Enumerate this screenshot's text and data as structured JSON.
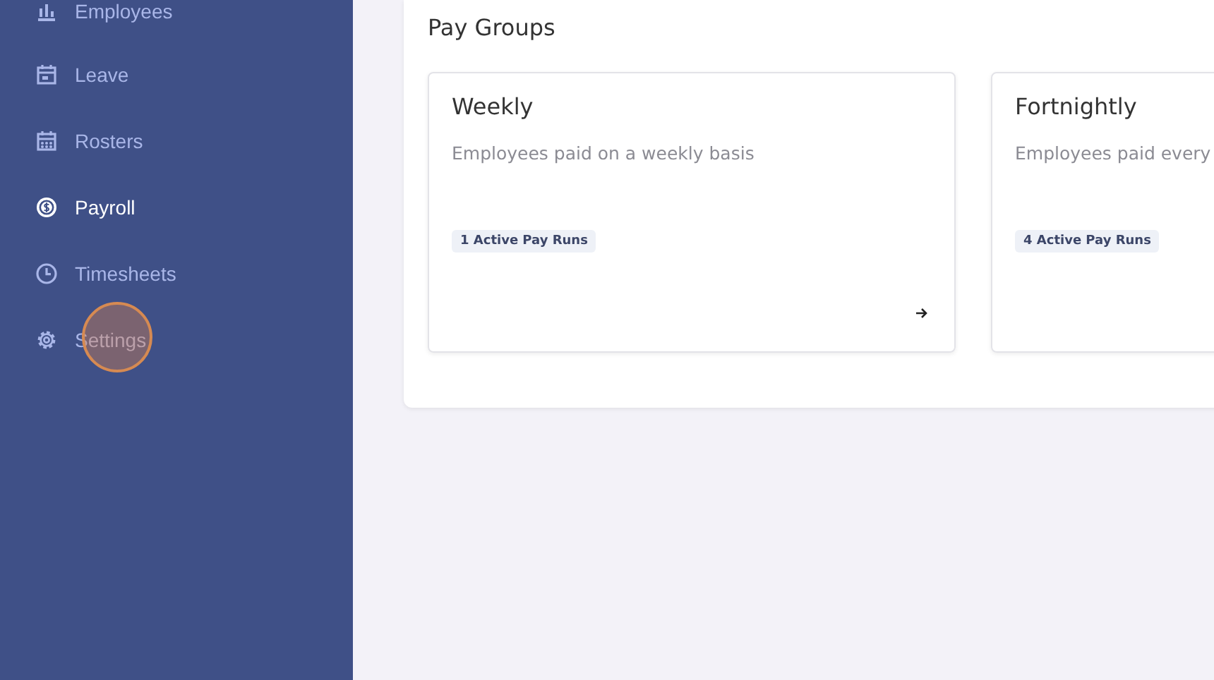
{
  "sidebar": {
    "items": [
      {
        "label": "Employees",
        "kind": "chart",
        "selected": false
      },
      {
        "label": "Leave",
        "kind": "calendar",
        "selected": false
      },
      {
        "label": "Rosters",
        "kind": "roster",
        "selected": false
      },
      {
        "label": "Payroll",
        "kind": "payroll",
        "selected": true
      },
      {
        "label": "Timesheets",
        "kind": "clock",
        "selected": false
      },
      {
        "label": "Settings",
        "kind": "settings",
        "selected": false
      }
    ]
  },
  "pay_groups": {
    "title": "Pay Groups",
    "cards": [
      {
        "name": "Weekly",
        "description": "Employees paid on a weekly basis",
        "badge": "1 Active Pay Runs"
      },
      {
        "name": "Fortnightly",
        "description": "Employees paid every",
        "badge": "4 Active Pay Runs"
      }
    ]
  }
}
